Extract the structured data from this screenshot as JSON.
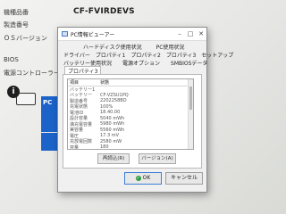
{
  "background": {
    "rows": [
      "機種品番",
      "製造番号",
      "ＯＳバージョン",
      "BIOS",
      "電源コントローラー"
    ],
    "model_number": "CF-FVIRDEVS",
    "info_icon_char": "i",
    "blue_block_label": "PC"
  },
  "dialog": {
    "title": "PC情報ビューアー",
    "tabs_row1": [
      "ハードディスク使用状況",
      "PC使用状況"
    ],
    "tabs_row2": [
      "ドライバー",
      "プロパティ1",
      "プロパティ2",
      "プロパティ3",
      "セットアップ"
    ],
    "tabs_row3": [
      "バッテリー使用状況",
      "電源オプション",
      "SMBIOSデータ"
    ],
    "tabs_row4": [
      "プロパティ3"
    ],
    "list": {
      "headers": [
        "項目",
        "状態"
      ],
      "rows": [
        [
          "バッテリー1",
          ""
        ],
        [
          "バッテリー",
          "CF-VZSU1PQ"
        ],
        [
          "製造番号",
          "2202258BD"
        ],
        [
          "充電状態",
          "100%"
        ],
        [
          "電池ID",
          "18.40.00"
        ],
        [
          "設計容量",
          "5040 mWh"
        ],
        [
          "満充電容量",
          "5980 mWh"
        ],
        [
          "実容量",
          "5560 mWh"
        ],
        [
          "電圧",
          "17.3 mV"
        ],
        [
          "充放電回数",
          "2580 mW"
        ],
        [
          "容量",
          "180"
        ],
        [
          "劣化度",
          "2020/02/25"
        ]
      ]
    },
    "refresh_label": "再読込(R)",
    "version_label": "バージョン(A)",
    "ok_label": "OK",
    "cancel_label": "キャンセル"
  }
}
